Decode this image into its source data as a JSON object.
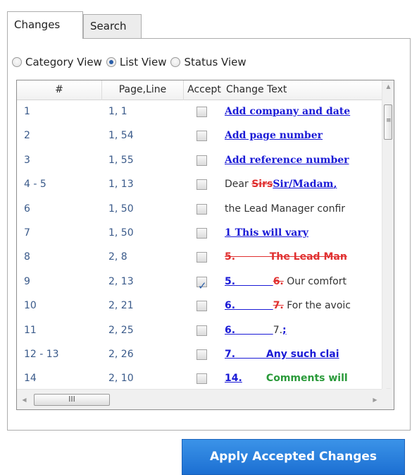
{
  "tabs": [
    {
      "label": "Changes",
      "active": true
    },
    {
      "label": "Search",
      "active": false
    }
  ],
  "view_options": [
    {
      "label": "Category View",
      "checked": false
    },
    {
      "label": "List View",
      "checked": true
    },
    {
      "label": "Status View",
      "checked": false
    }
  ],
  "grid": {
    "headers": {
      "num": "#",
      "page": "Page,Line",
      "accept": "Accept",
      "text": "Change Text"
    },
    "rows": [
      {
        "num": "1",
        "page": "1, 1",
        "accepted": false,
        "parts": [
          {
            "t": "Add company and date",
            "s": "ins"
          }
        ]
      },
      {
        "num": "2",
        "page": "1, 54",
        "accepted": false,
        "parts": [
          {
            "t": "Add page number",
            "s": "ins"
          }
        ]
      },
      {
        "num": "3",
        "page": "1, 55",
        "accepted": false,
        "parts": [
          {
            "t": "Add reference number",
            "s": "ins"
          }
        ]
      },
      {
        "num": "4 - 5",
        "page": "1, 13",
        "accepted": false,
        "parts": [
          {
            "t": "Dear ",
            "s": "plain"
          },
          {
            "t": "Sirs",
            "s": "del"
          },
          {
            "t": "Sir/Madam",
            "s": "ins"
          },
          {
            "t": ",",
            "s": "ins"
          }
        ]
      },
      {
        "num": "6",
        "page": "1, 50",
        "accepted": false,
        "parts": [
          {
            "t": "the Lead Manager confir",
            "s": "plain"
          }
        ]
      },
      {
        "num": "7",
        "page": "1, 50",
        "accepted": false,
        "parts": [
          {
            "t": "1 This will vary",
            "s": "ins"
          }
        ]
      },
      {
        "num": "8",
        "page": "2, 8",
        "accepted": false,
        "parts": [
          {
            "t": "5.          The Lead Man",
            "s": "del"
          }
        ]
      },
      {
        "num": "9",
        "page": "2, 13",
        "accepted": true,
        "parts": [
          {
            "t": "5.",
            "s": "ins-sans"
          },
          {
            "t": "           ",
            "s": "ins-sans"
          },
          {
            "t": "6.",
            "s": "del"
          },
          {
            "t": " Our comfort",
            "s": "plain"
          }
        ]
      },
      {
        "num": "10",
        "page": "2, 21",
        "accepted": false,
        "parts": [
          {
            "t": "6.",
            "s": "ins-sans"
          },
          {
            "t": "           ",
            "s": "ins-sans"
          },
          {
            "t": "7.",
            "s": "del"
          },
          {
            "t": " For the avoic",
            "s": "plain"
          }
        ]
      },
      {
        "num": "11",
        "page": "2, 25",
        "accepted": false,
        "parts": [
          {
            "t": "6.",
            "s": "ins-sans"
          },
          {
            "t": "           ",
            "s": "ins-sans"
          },
          {
            "t": "7.",
            "s": "plain"
          },
          {
            "t": ";",
            "s": "ins-sans"
          }
        ]
      },
      {
        "num": "12 - 13",
        "page": "2, 26",
        "accepted": false,
        "parts": [
          {
            "t": "7.",
            "s": "ins-sans"
          },
          {
            "t": "         Any such clai",
            "s": "ins-sans"
          }
        ]
      },
      {
        "num": "14",
        "page": "2, 10",
        "accepted": false,
        "parts": [
          {
            "t": "14.",
            "s": "ins-sans"
          },
          {
            "t": "       Comments will",
            "s": "green"
          }
        ]
      }
    ]
  },
  "apply_button": {
    "label": "Apply Accepted Changes"
  },
  "colors": {
    "accent": "#1c6fd2",
    "inserted": "#1a1ad6",
    "deleted": "#e03030"
  }
}
